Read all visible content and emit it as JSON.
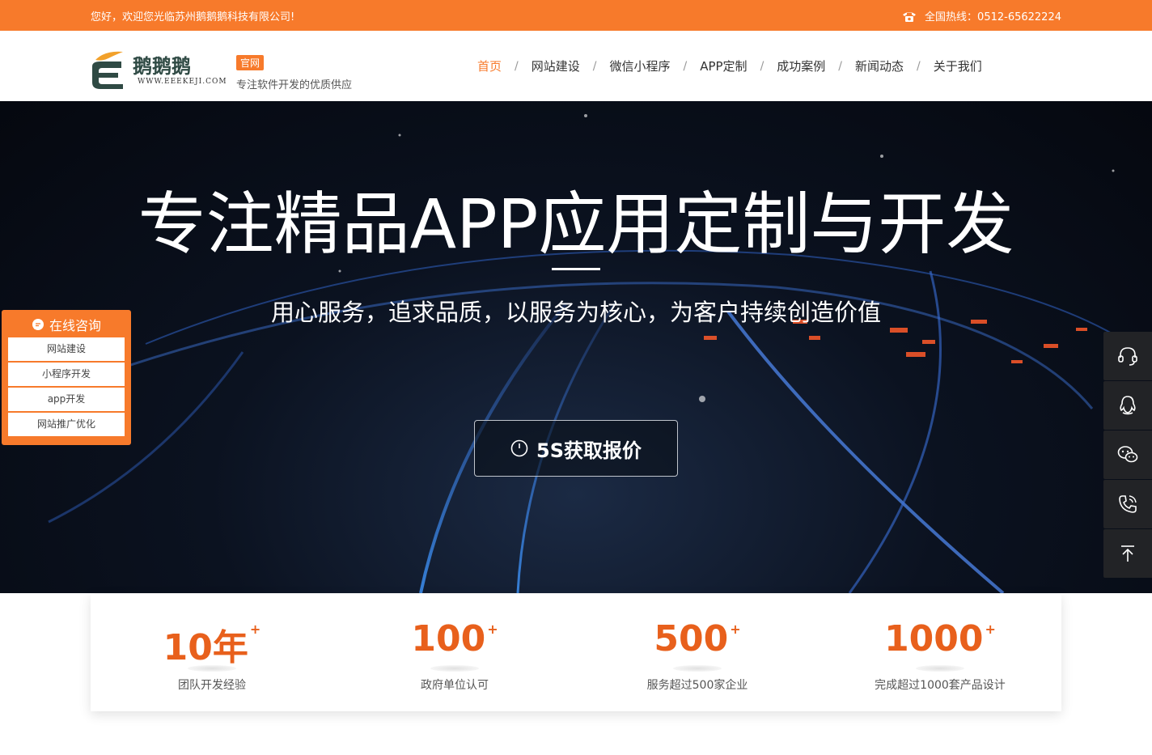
{
  "topbar": {
    "welcome": "您好，欢迎您光临苏州鹅鹅鹅科技有限公司!",
    "hotline_label": "全国热线：",
    "hotline_number": "0512-65622224",
    "icon": "phone-icon"
  },
  "header": {
    "logo_script": "鹅鹅鹅",
    "logo_url": "WWW.EEEKEJI.COM",
    "badge": "官网",
    "tagline": "专注软件开发的优质供应",
    "nav": [
      {
        "label": "首页",
        "active": true
      },
      {
        "label": "网站建设"
      },
      {
        "label": "微信小程序"
      },
      {
        "label": "APP定制"
      },
      {
        "label": "成功案例"
      },
      {
        "label": "新闻动态"
      },
      {
        "label": "关于我们"
      }
    ],
    "nav_separator": "/"
  },
  "hero": {
    "title": "专注精品APP应用定制与开发",
    "subtitle": "用心服务，追求品质，以服务为核心，为客户持续创造价值",
    "button_label": "5S获取报价",
    "button_icon": "clock-icon"
  },
  "consult": {
    "title": "在线咨询",
    "icon": "chat-bubble-icon",
    "items": [
      "网站建设",
      "小程序开发",
      "app开发",
      "网站推广优化"
    ]
  },
  "floatbar": {
    "buttons": [
      "headset-icon",
      "qq-icon",
      "wechat-icon",
      "phone-call-icon",
      "back-to-top-icon"
    ]
  },
  "stats": [
    {
      "number": "10年",
      "suffix": "+",
      "label": "团队开发经验"
    },
    {
      "number": "100",
      "suffix": "+",
      "label": "政府单位认可"
    },
    {
      "number": "500",
      "suffix": "+",
      "label": "服务超过500家企业"
    },
    {
      "number": "1000",
      "suffix": "+",
      "label": "完成超过1000套产品设计"
    }
  ],
  "colors": {
    "accent": "#f77a2b",
    "stat_number": "#e8601c",
    "float_bg": "#222326"
  }
}
